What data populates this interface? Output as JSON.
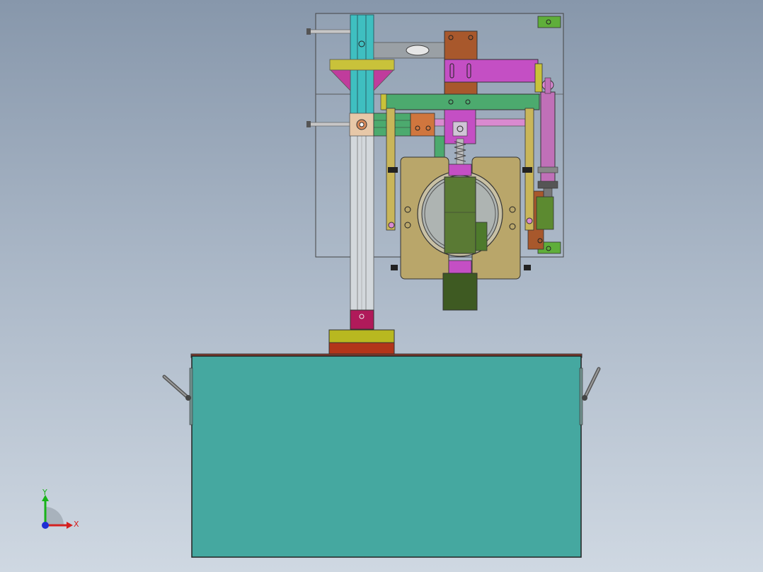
{
  "viewport": {
    "background_top": "#8797ab",
    "background_bottom": "#cfd8e2"
  },
  "triad": {
    "x_label": "X",
    "y_label": "Y",
    "x_color": "#d42020",
    "y_color": "#19b319",
    "z_color": "#1f2fd4"
  },
  "colors": {
    "base_box": "#45a8a0",
    "teal_rail": "#3fbfc0",
    "olive": "#c9b65a",
    "magenta": "#c44fc4",
    "pink_cylinder": "#c070b8",
    "brown": "#a8582c",
    "green_plate": "#4caa6e",
    "dark_green": "#3e5a22",
    "crimson": "#b01a5a",
    "yellow_green": "#b8b820",
    "rust_red": "#b2351a",
    "tan_block": "#b9a66a"
  }
}
